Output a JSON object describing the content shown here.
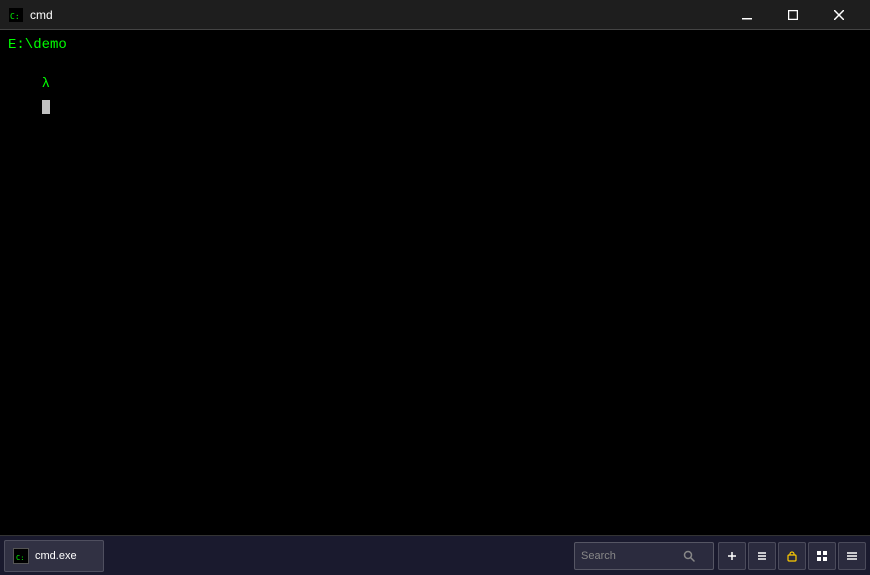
{
  "titlebar": {
    "icon_label": "cmd-icon",
    "title": "cmd",
    "minimize_label": "minimize-button",
    "maximize_label": "maximize-button",
    "close_label": "close-button"
  },
  "terminal": {
    "line1": "E:\\demo",
    "line2": "λ"
  },
  "taskbar": {
    "app_label": "cmd.exe",
    "search_placeholder": "Search",
    "colors": {
      "terminal_bg": "#000000",
      "terminal_text": "#00ff00",
      "titlebar_bg": "#1e1e1e"
    }
  }
}
